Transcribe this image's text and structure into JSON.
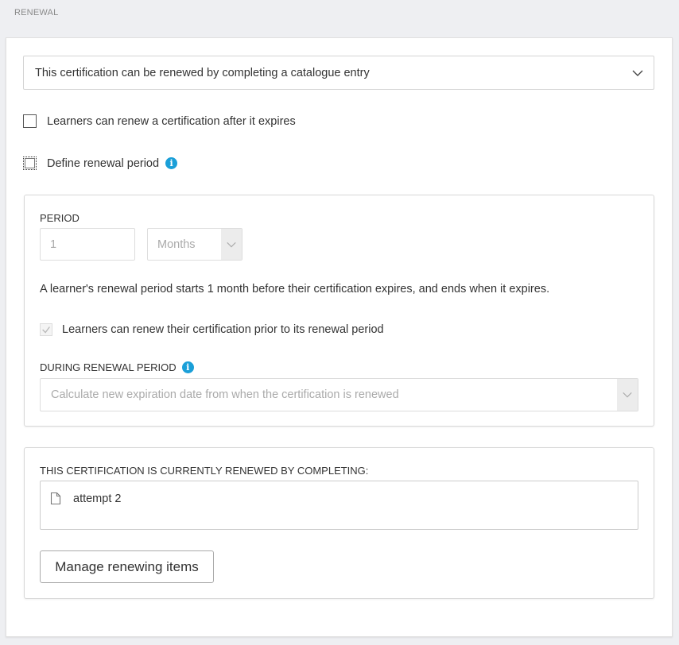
{
  "section_label": "RENEWAL",
  "renewal_method": {
    "selected": "This certification can be renewed by completing a catalogue entry",
    "icon": "chevron-down-icon"
  },
  "options": {
    "after_expiry_label": "Learners can renew a certification after it expires",
    "after_expiry_checked": false,
    "define_period_label": "Define renewal period",
    "define_period_checked": false
  },
  "period_panel": {
    "label": "PERIOD",
    "value": "1",
    "unit": "Months",
    "description": "A learner's renewal period starts 1 month before their certification expires, and ends when it expires.",
    "prior_label": "Learners can renew their certification prior to its renewal period",
    "prior_checked": true,
    "during_label": "DURING RENEWAL PERIOD",
    "during_selected": "Calculate new expiration date from when the certification is renewed"
  },
  "items_panel": {
    "label": "THIS CERTIFICATION IS CURRENTLY RENEWED BY COMPLETING:",
    "items": [
      {
        "name": "attempt 2",
        "icon": "document-icon"
      }
    ],
    "manage_button": "Manage renewing items"
  },
  "colors": {
    "accent": "#1a9fd8",
    "background": "#eeeff2"
  }
}
